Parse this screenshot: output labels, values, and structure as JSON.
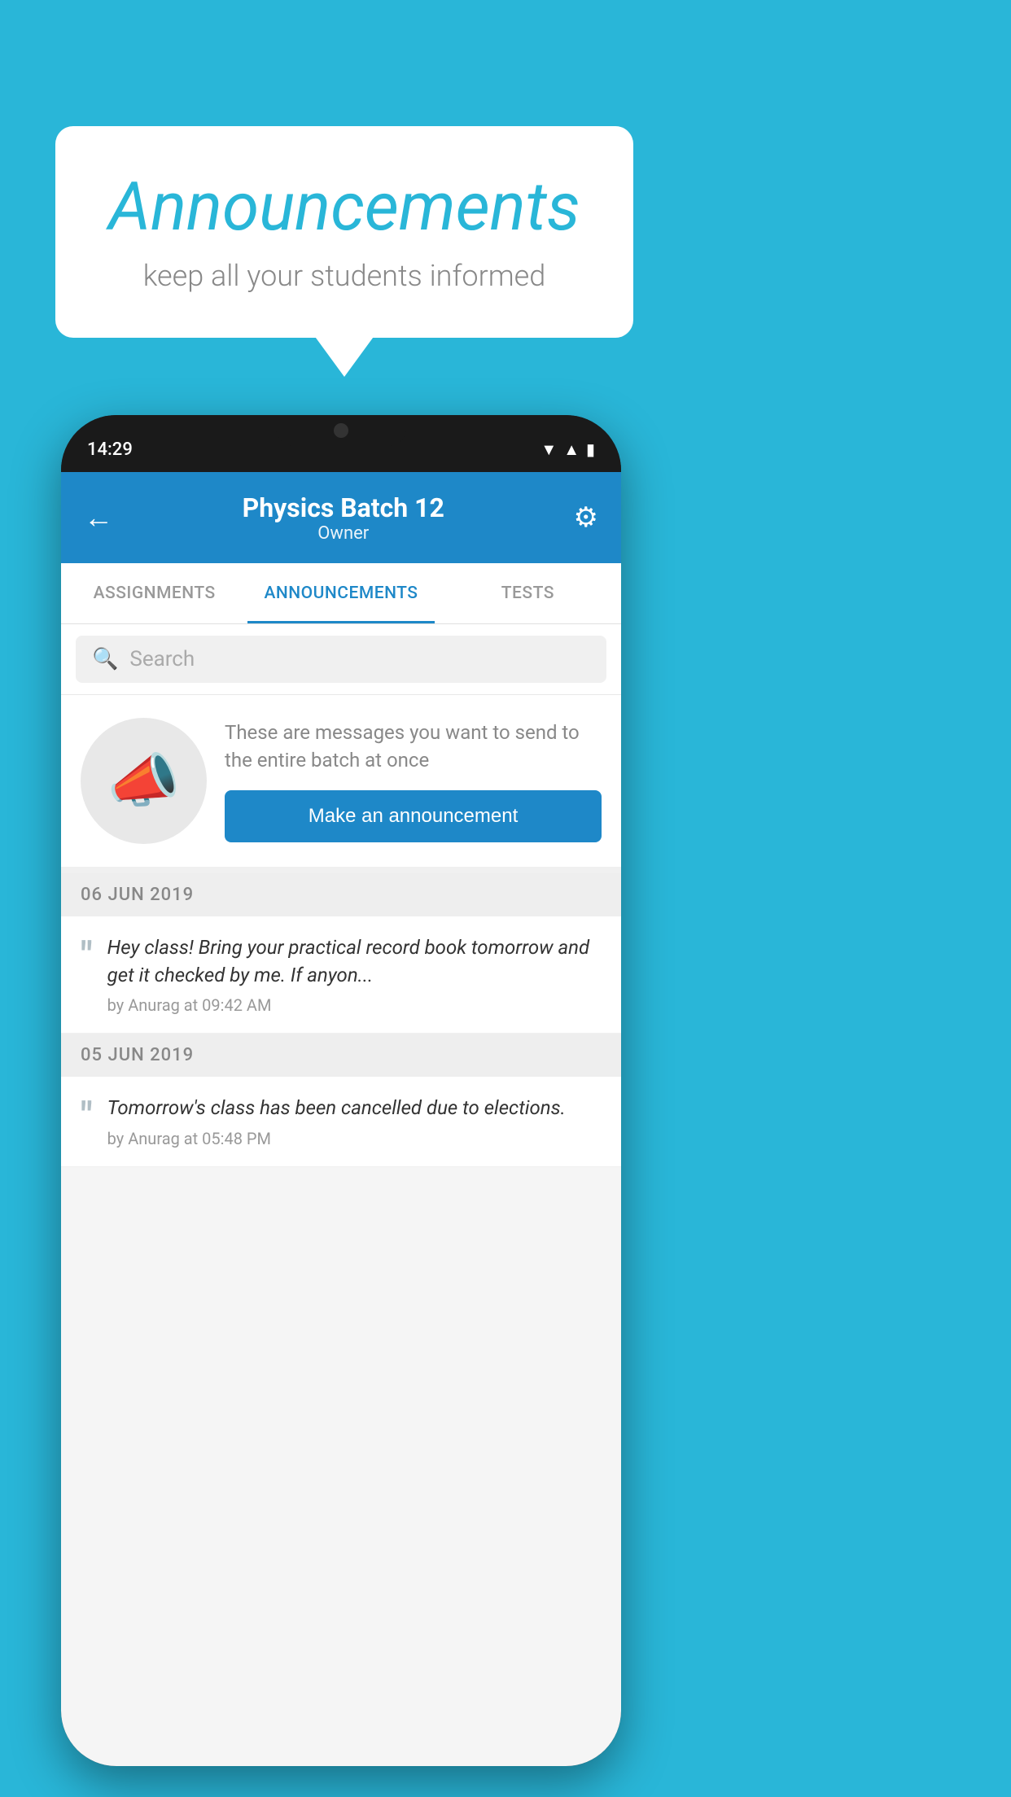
{
  "background": {
    "color": "#29B6D8"
  },
  "speech_bubble": {
    "title": "Announcements",
    "subtitle": "keep all your students informed"
  },
  "phone": {
    "status_bar": {
      "time": "14:29",
      "icons": [
        "wifi",
        "signal",
        "battery"
      ]
    },
    "header": {
      "title": "Physics Batch 12",
      "subtitle": "Owner",
      "back_label": "←",
      "settings_label": "⚙"
    },
    "tabs": [
      {
        "label": "ASSIGNMENTS",
        "active": false
      },
      {
        "label": "ANNOUNCEMENTS",
        "active": true
      },
      {
        "label": "TESTS",
        "active": false
      },
      {
        "label": "...",
        "active": false
      }
    ],
    "search": {
      "placeholder": "Search"
    },
    "announcement_prompt": {
      "message": "These are messages you want to send to the entire batch at once",
      "button_label": "Make an announcement"
    },
    "announcements": [
      {
        "date": "06  JUN  2019",
        "text": "Hey class! Bring your practical record book tomorrow and get it checked by me. If anyon...",
        "meta": "by Anurag at 09:42 AM"
      },
      {
        "date": "05  JUN  2019",
        "text": "Tomorrow's class has been cancelled due to elections.",
        "meta": "by Anurag at 05:48 PM"
      }
    ]
  }
}
